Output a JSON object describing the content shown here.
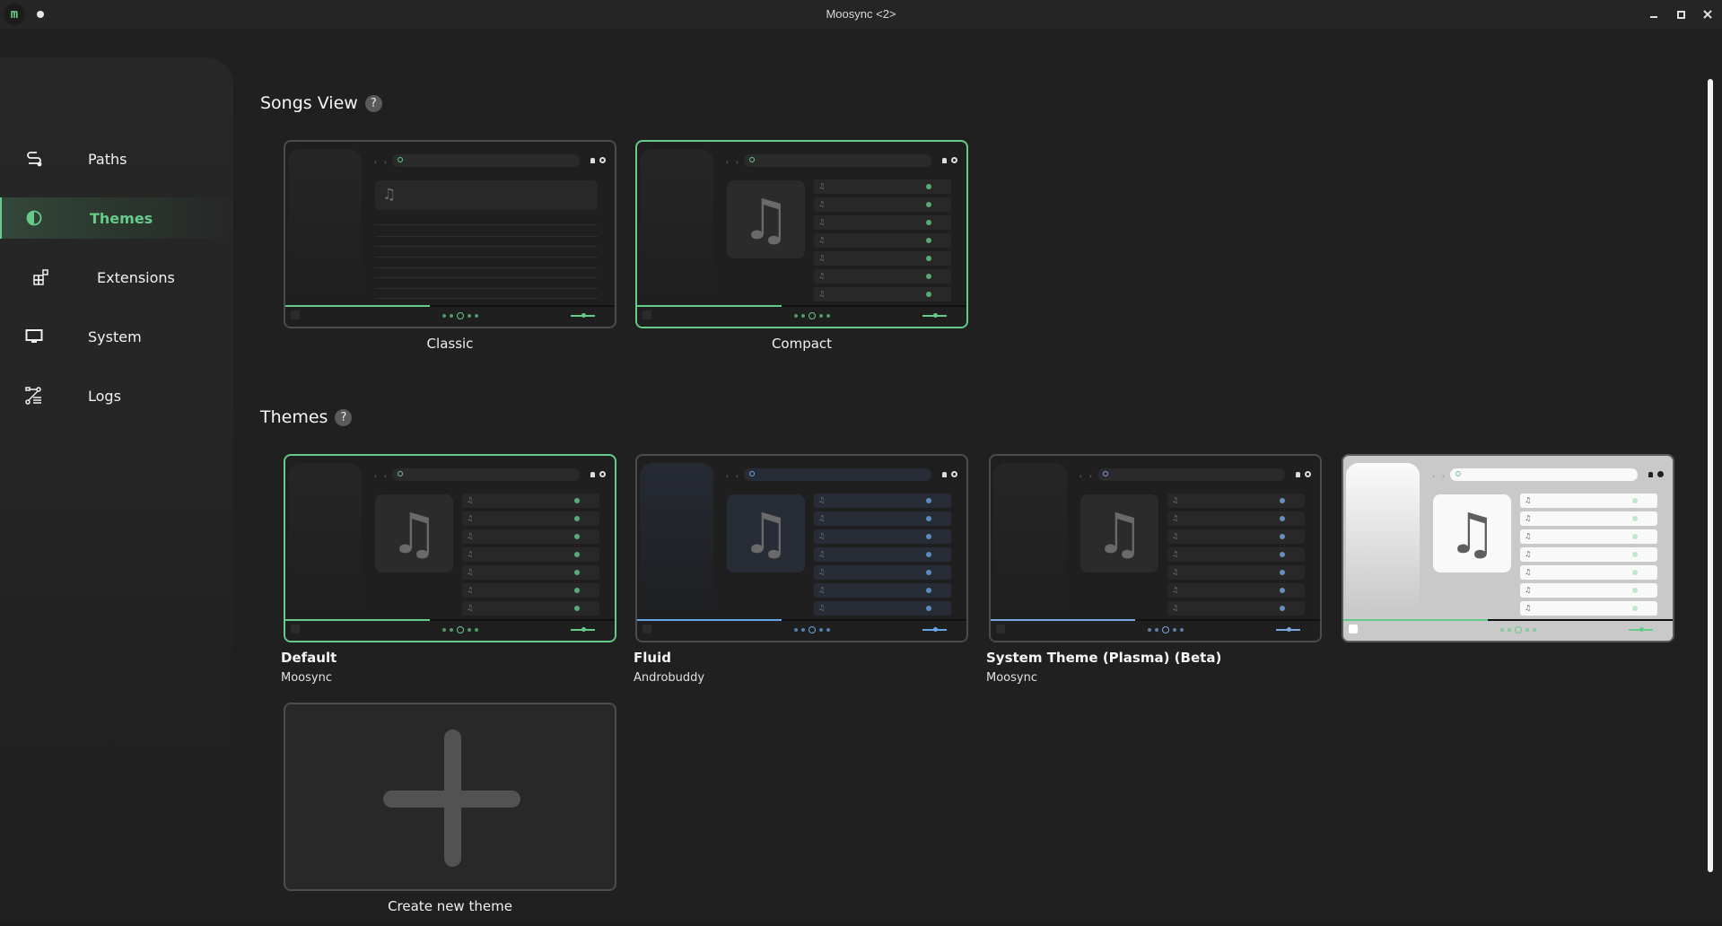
{
  "window": {
    "title": "Moosync <2>",
    "logo_letter": "m",
    "controls": {
      "minimize": "minimize-icon",
      "maximize": "maximize-icon",
      "close": "close-icon"
    }
  },
  "sidebar": {
    "items": [
      {
        "label": "Paths",
        "icon": "path-icon",
        "active": false
      },
      {
        "label": "Themes",
        "icon": "contrast-icon",
        "active": true
      },
      {
        "label": "Extensions",
        "icon": "extensions-icon",
        "active": false
      },
      {
        "label": "System",
        "icon": "monitor-icon",
        "active": false
      },
      {
        "label": "Logs",
        "icon": "logs-icon",
        "active": false
      }
    ],
    "accent_color": "#65cb88"
  },
  "songs_view": {
    "title": "Songs View",
    "help": "?",
    "options": [
      {
        "label": "Classic",
        "selected": false
      },
      {
        "label": "Compact",
        "selected": true
      }
    ]
  },
  "themes": {
    "title": "Themes",
    "help": "?",
    "items": [
      {
        "name": "Default",
        "author": "Moosync",
        "selected": true,
        "accent": "#65cb88"
      },
      {
        "name": "Fluid",
        "author": "Androbuddy",
        "selected": false,
        "accent": "#64a6e8"
      },
      {
        "name": "System Theme (Plasma) (Beta)",
        "author": "Moosync",
        "selected": false,
        "accent": "#7aa7e0"
      },
      {
        "name": "",
        "author": "",
        "selected": false,
        "accent": "#65cb88"
      }
    ],
    "create_label": "Create new theme",
    "preview_progress": 0.44
  },
  "preview": {
    "nav_arrows": "‹ ›",
    "note_glyph": "♫",
    "big_note": "♫"
  }
}
